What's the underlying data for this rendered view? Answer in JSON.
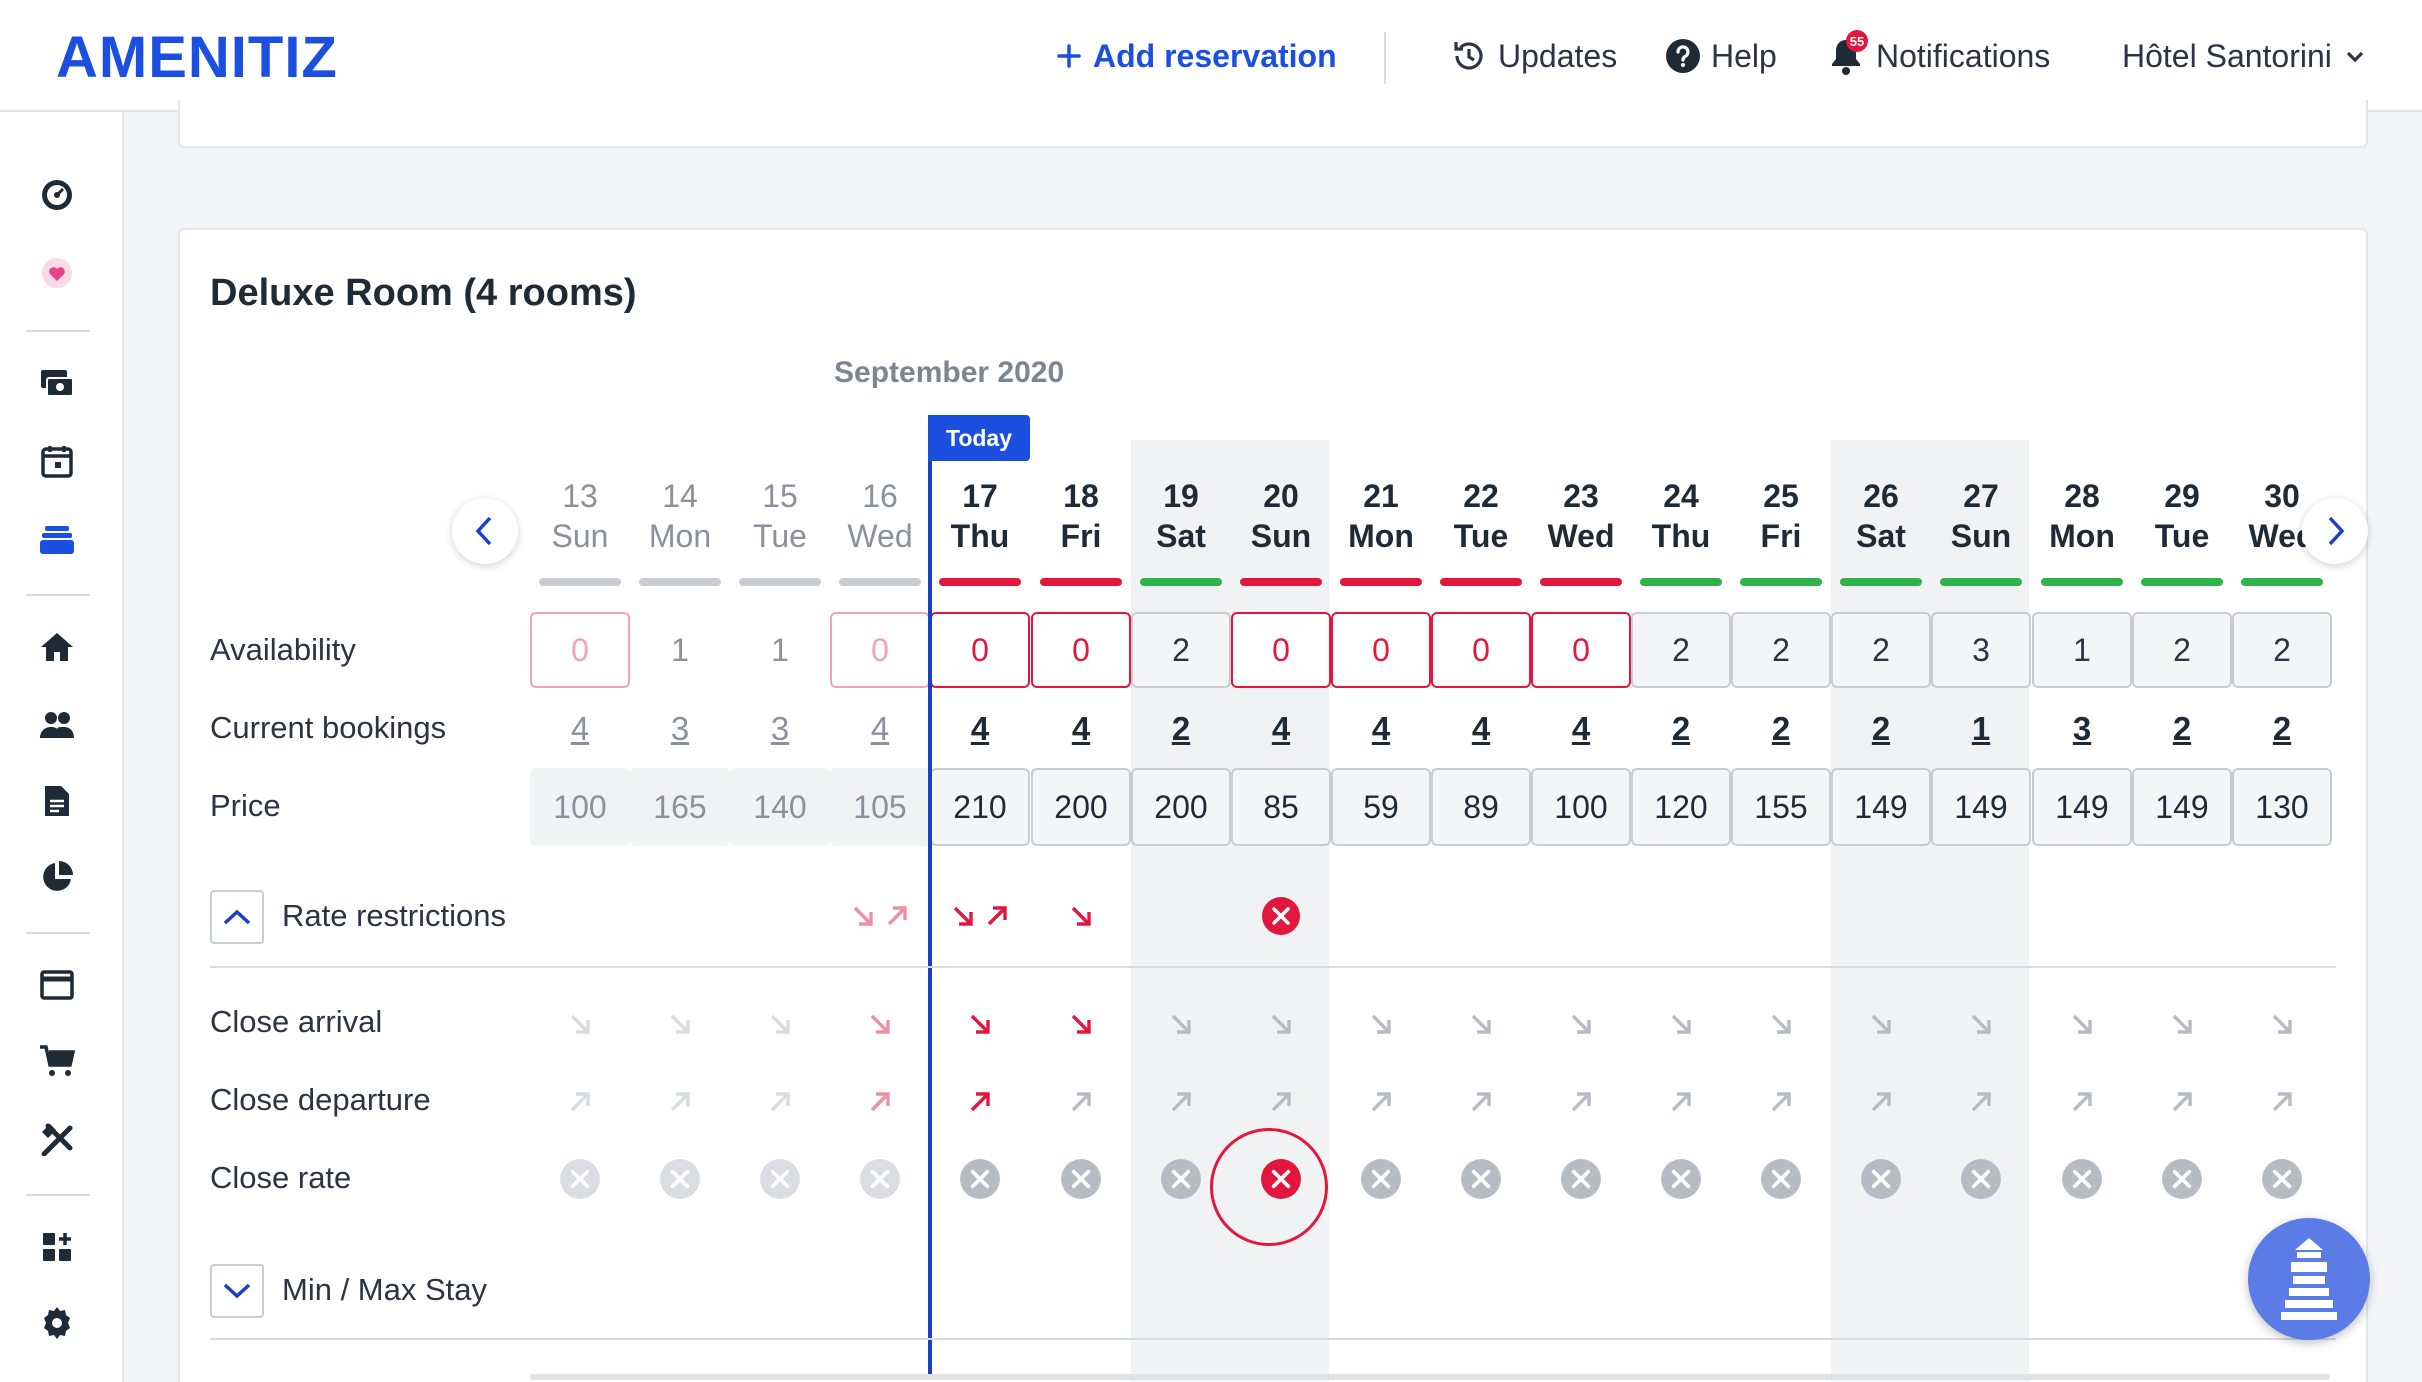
{
  "topbar": {
    "logo": "AMENITIZ",
    "add_reservation": "Add reservation",
    "updates": "Updates",
    "help": "Help",
    "notifications": "Notifications",
    "notifications_count": "55",
    "hotel": "Hôtel Santorini"
  },
  "sidebar": {
    "icons": [
      "dashboard-icon",
      "heart-icon",
      "money-icon",
      "calendar-icon",
      "rates-stack-icon",
      "home-icon",
      "guests-icon",
      "document-icon",
      "pie-chart-icon",
      "website-icon",
      "cart-icon",
      "tools-icon",
      "apps-icon",
      "gear-icon"
    ],
    "active": "rates-stack-icon"
  },
  "room": {
    "title": "Deluxe Room (4 rooms)",
    "month": "September 2020",
    "today_label": "Today"
  },
  "rows": {
    "availability": "Availability",
    "current_bookings": "Current bookings",
    "price": "Price",
    "rate_restrictions": "Rate restrictions",
    "close_arrival": "Close arrival",
    "close_departure": "Close departure",
    "close_rate": "Close rate",
    "min_max_stay": "Min / Max Stay"
  },
  "colors": {
    "brand": "#1a4fe0",
    "red": "#e3173e",
    "green": "#2fb24a",
    "grey_bar": "#c9ccd2"
  },
  "days": [
    {
      "num": "13",
      "name": "Sun",
      "past": true,
      "bar": "grey",
      "availability": "0",
      "bookings": "4",
      "price": "100",
      "close_arrival": false,
      "close_departure": false,
      "close_rate": false,
      "weekend": false
    },
    {
      "num": "14",
      "name": "Mon",
      "past": true,
      "bar": "grey",
      "availability": "1",
      "bookings": "3",
      "price": "165",
      "close_arrival": false,
      "close_departure": false,
      "close_rate": false,
      "weekend": false
    },
    {
      "num": "15",
      "name": "Tue",
      "past": true,
      "bar": "grey",
      "availability": "1",
      "bookings": "3",
      "price": "140",
      "close_arrival": false,
      "close_departure": false,
      "close_rate": false,
      "weekend": false
    },
    {
      "num": "16",
      "name": "Wed",
      "past": true,
      "bar": "grey",
      "availability": "0",
      "bookings": "4",
      "price": "105",
      "close_arrival": true,
      "close_departure": true,
      "close_rate": false,
      "weekend": false
    },
    {
      "num": "17",
      "name": "Thu",
      "past": false,
      "bar": "red",
      "availability": "0",
      "bookings": "4",
      "price": "210",
      "close_arrival": true,
      "close_departure": true,
      "close_rate": false,
      "weekend": false
    },
    {
      "num": "18",
      "name": "Fri",
      "past": false,
      "bar": "red",
      "availability": "0",
      "bookings": "4",
      "price": "200",
      "close_arrival": true,
      "close_departure": false,
      "close_rate": false,
      "weekend": false
    },
    {
      "num": "19",
      "name": "Sat",
      "past": false,
      "bar": "green",
      "availability": "2",
      "bookings": "2",
      "price": "200",
      "close_arrival": false,
      "close_departure": false,
      "close_rate": false,
      "weekend": true
    },
    {
      "num": "20",
      "name": "Sun",
      "past": false,
      "bar": "red",
      "availability": "0",
      "bookings": "4",
      "price": "85",
      "close_arrival": false,
      "close_departure": false,
      "close_rate": true,
      "weekend": true
    },
    {
      "num": "21",
      "name": "Mon",
      "past": false,
      "bar": "red",
      "availability": "0",
      "bookings": "4",
      "price": "59",
      "close_arrival": false,
      "close_departure": false,
      "close_rate": false,
      "weekend": false
    },
    {
      "num": "22",
      "name": "Tue",
      "past": false,
      "bar": "red",
      "availability": "0",
      "bookings": "4",
      "price": "89",
      "close_arrival": false,
      "close_departure": false,
      "close_rate": false,
      "weekend": false
    },
    {
      "num": "23",
      "name": "Wed",
      "past": false,
      "bar": "red",
      "availability": "0",
      "bookings": "4",
      "price": "100",
      "close_arrival": false,
      "close_departure": false,
      "close_rate": false,
      "weekend": false
    },
    {
      "num": "24",
      "name": "Thu",
      "past": false,
      "bar": "green",
      "availability": "2",
      "bookings": "2",
      "price": "120",
      "close_arrival": false,
      "close_departure": false,
      "close_rate": false,
      "weekend": false
    },
    {
      "num": "25",
      "name": "Fri",
      "past": false,
      "bar": "green",
      "availability": "2",
      "bookings": "2",
      "price": "155",
      "close_arrival": false,
      "close_departure": false,
      "close_rate": false,
      "weekend": false
    },
    {
      "num": "26",
      "name": "Sat",
      "past": false,
      "bar": "green",
      "availability": "2",
      "bookings": "2",
      "price": "149",
      "close_arrival": false,
      "close_departure": false,
      "close_rate": false,
      "weekend": true
    },
    {
      "num": "27",
      "name": "Sun",
      "past": false,
      "bar": "green",
      "availability": "3",
      "bookings": "1",
      "price": "149",
      "close_arrival": false,
      "close_departure": false,
      "close_rate": false,
      "weekend": true
    },
    {
      "num": "28",
      "name": "Mon",
      "past": false,
      "bar": "green",
      "availability": "1",
      "bookings": "3",
      "price": "149",
      "close_arrival": false,
      "close_departure": false,
      "close_rate": false,
      "weekend": false
    },
    {
      "num": "29",
      "name": "Tue",
      "past": false,
      "bar": "green",
      "availability": "2",
      "bookings": "2",
      "price": "149",
      "close_arrival": false,
      "close_departure": false,
      "close_rate": false,
      "weekend": false
    },
    {
      "num": "30",
      "name": "Wed",
      "past": false,
      "bar": "green",
      "availability": "2",
      "bookings": "2",
      "price": "130",
      "close_arrival": false,
      "close_departure": false,
      "close_rate": false,
      "weekend": false
    }
  ]
}
